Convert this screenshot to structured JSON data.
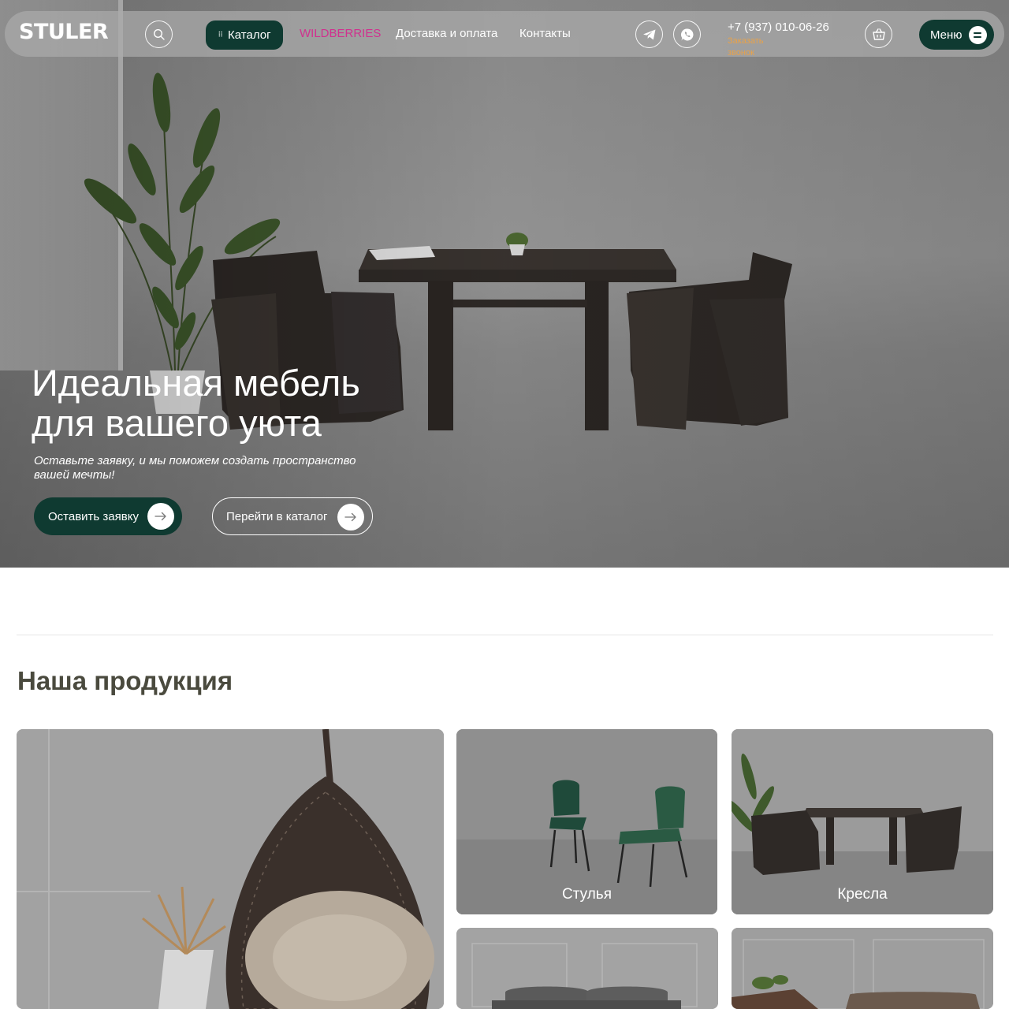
{
  "header": {
    "logo": "STULER",
    "catalog_label": "Каталог",
    "nav": {
      "wildberries": "WILDBERRIES",
      "delivery": "Доставка и оплата",
      "contacts": "Контакты"
    },
    "phone": "+7 (937) 010-06-26",
    "callback": "Заказать звонок",
    "menu_label": "Меню"
  },
  "hero": {
    "title_line1": "Идеальная мебель",
    "title_line2": "для вашего уюта",
    "subtitle": "Оставьте заявку, и мы поможем создать пространство вашей мечты!",
    "btn_request": "Оставить заявку",
    "btn_catalog": "Перейти в каталог"
  },
  "products": {
    "title": "Наша продукция",
    "cards": [
      {
        "label": ""
      },
      {
        "label": "Стулья"
      },
      {
        "label": "Кресла"
      },
      {
        "label": ""
      },
      {
        "label": ""
      }
    ]
  },
  "colors": {
    "brand_green": "#0f3a31",
    "wildberries": "#d0318f",
    "callback": "#e8a24a"
  },
  "icons": [
    "search-icon",
    "catalog-dots-icon",
    "telegram-icon",
    "whatsapp-icon",
    "basket-icon",
    "burger-icon",
    "arrow-right-icon"
  ]
}
